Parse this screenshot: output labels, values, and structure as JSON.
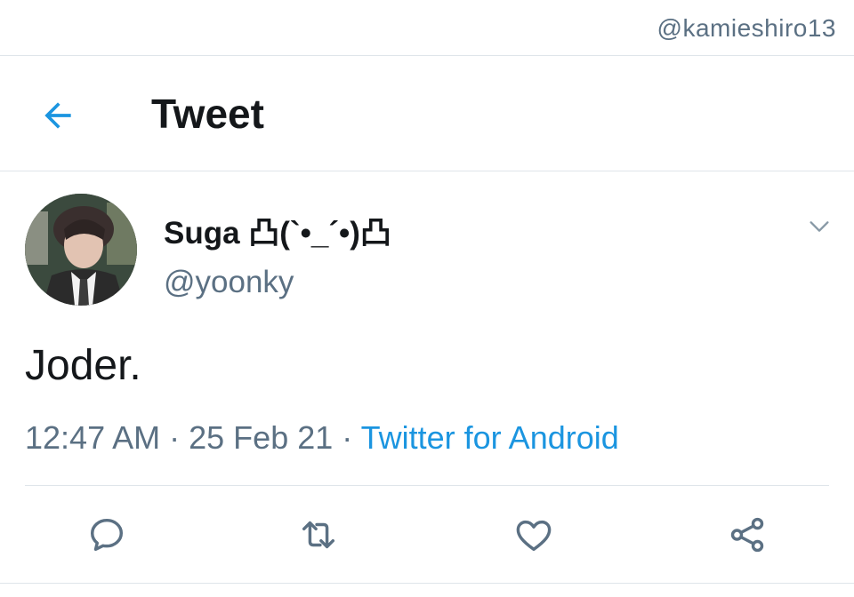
{
  "status_bar": {
    "handle": "@kamieshiro13"
  },
  "header": {
    "title": "Tweet",
    "back_icon": "arrow-left-icon"
  },
  "tweet": {
    "author": {
      "display_name": "Suga 凸(`•_´•)凸",
      "handle": "@yoonky"
    },
    "text": "Joder.",
    "time": "12:47 AM",
    "date": "25 Feb 21",
    "separator": "·",
    "source": "Twitter for Android"
  },
  "actions": [
    {
      "name": "reply",
      "icon": "reply-icon"
    },
    {
      "name": "retweet",
      "icon": "retweet-icon"
    },
    {
      "name": "like",
      "icon": "heart-icon"
    },
    {
      "name": "share",
      "icon": "share-icon"
    }
  ],
  "colors": {
    "accent": "#1b95e0",
    "text_primary": "#14171a",
    "text_secondary": "#5b7083",
    "divider": "#dfe5ea"
  }
}
